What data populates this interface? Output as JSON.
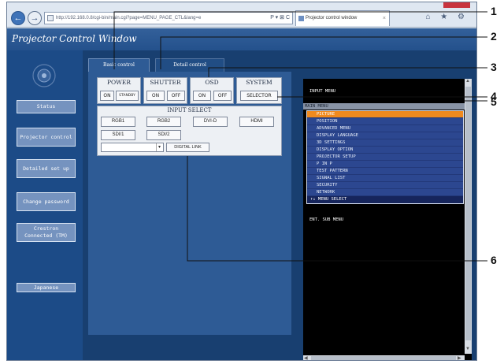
{
  "browser": {
    "url": "http://192.168.0.8/cgi-bin/main.cgi?page=MENU_PAGE_CTL&lang=e",
    "url_tools": "P ▾ ⊠ C",
    "tab_title": "Projector control window",
    "tab_close": "×",
    "back": "←",
    "forward": "→",
    "right_icons": "⌂ ★ ⚙"
  },
  "page": {
    "title": "Projector Control Window"
  },
  "nav": {
    "items": [
      {
        "label": "Status"
      },
      {
        "label": "Projector control"
      },
      {
        "label": "Detailed set up"
      },
      {
        "label": "Change password"
      },
      {
        "label": "Crestron Connected (TM)"
      },
      {
        "label": "Japanese"
      }
    ]
  },
  "tabs": {
    "basic": "Basic control",
    "detail": "Detail control"
  },
  "controls": {
    "power": {
      "title": "POWER",
      "on": "ON",
      "standby": "STANDBY"
    },
    "shutter": {
      "title": "SHUTTER",
      "on": "ON",
      "off": "OFF"
    },
    "osd": {
      "title": "OSD",
      "on": "ON",
      "off": "OFF"
    },
    "system": {
      "title": "SYSTEM",
      "selector": "SELECTOR"
    }
  },
  "input_select": {
    "title": "INPUT SELECT",
    "buttons": [
      "RGB1",
      "RGB2",
      "DVI-D",
      "HDMI",
      "SDI/1",
      "SDI/2"
    ],
    "dropdown_value": "",
    "dropdown_caret": "▾",
    "digital_link": "DIGITAL LINK"
  },
  "osd_screen": {
    "header": "INPUT MENU",
    "menu_title": "MAIN MENU",
    "items": [
      "PICTURE",
      "POSITION",
      "ADVANCED MENU",
      "DISPLAY LANGUAGE",
      "3D SETTINGS",
      "DISPLAY OPTION",
      "PROJECTOR SETUP",
      "P IN P",
      "TEST PATTERN",
      "SIGNAL LIST",
      "SECURITY",
      "NETWORK"
    ],
    "active_index": 0,
    "footer_select": "↑↓   MENU SELECT",
    "footer_enter": "ENT.  SUB MENU",
    "scroll_up": "▲",
    "scroll_down": "▼",
    "scroll_left": "◀",
    "scroll_right": "▶"
  },
  "callouts": [
    "1",
    "2",
    "3",
    "4",
    "5",
    "6"
  ],
  "colors": {
    "page_bg": "#1e4c86",
    "osd_highlight": "#f08a1e",
    "osd_list_bg": "#2c4790"
  }
}
